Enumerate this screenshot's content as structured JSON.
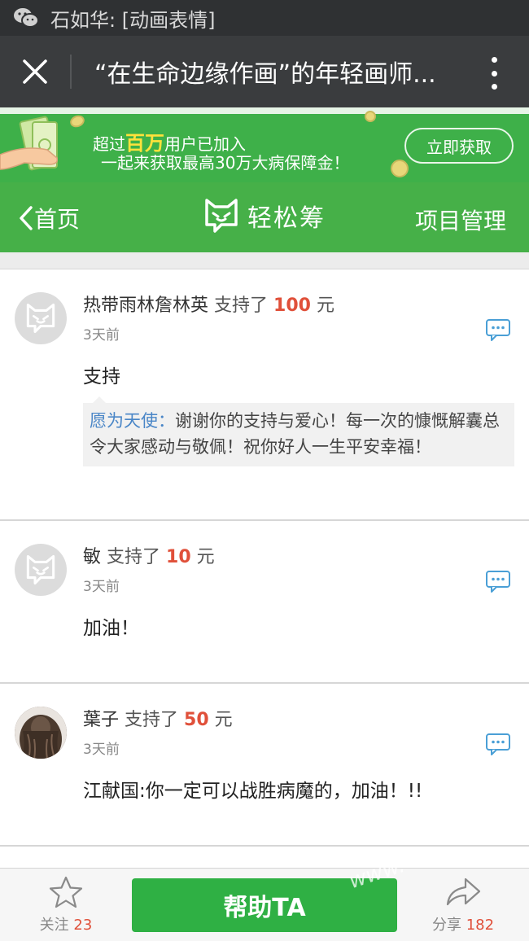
{
  "statusbar": {
    "title": "石如华: [动画表情]"
  },
  "titlebar": {
    "title": "“在生命边缘作画”的年轻画师..."
  },
  "banner": {
    "line1_prefix": "超过",
    "line1_highlight": "百万",
    "line1_suffix": "用户已加入",
    "line2": "一起来获取最高30万大病保障金！",
    "cta": "立即获取"
  },
  "nav": {
    "back_label": "首页",
    "brand": "轻松筹",
    "manage_label": "项目管理"
  },
  "donations": [
    {
      "name": "热带雨林詹林英",
      "support_text": "支持了",
      "amount": "100",
      "unit": "元",
      "time": "3天前",
      "message": "支持",
      "reply_author": "愿为天使：",
      "reply_text": "谢谢你的支持与爱心！每一次的慷慨解囊总令大家感动与敬佩！祝你好人一生平安幸福！"
    },
    {
      "name": "敏",
      "support_text": "支持了",
      "amount": "10",
      "unit": "元",
      "time": "3天前",
      "message": "加油！"
    },
    {
      "name": "葉子",
      "support_text": "支持了",
      "amount": "50",
      "unit": "元",
      "time": "3天前",
      "message": "江献国:你一定可以战胜病魔的，加油！!!"
    }
  ],
  "bottombar": {
    "follow_label": "关注",
    "follow_count": "23",
    "help_button": "帮助TA",
    "share_label": "分享",
    "share_count": "182"
  },
  "watermark": "www."
}
